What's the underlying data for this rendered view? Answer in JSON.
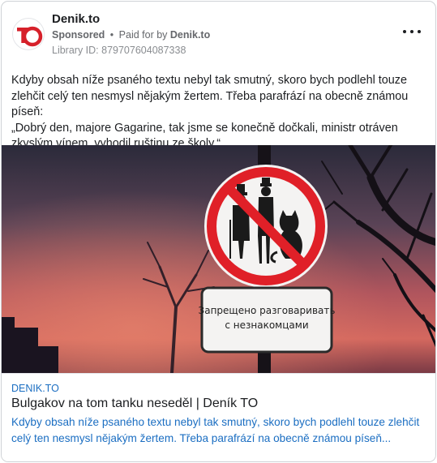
{
  "ad": {
    "page_name": "Denik.to",
    "logo_text": "TO",
    "sponsored_label": "Sponsored",
    "separator": "•",
    "paid_for_prefix": "Paid for by",
    "payer_name": "Denik.to",
    "library_id": "Library ID: 879707604087338",
    "primary_text": "Kdyby obsah níže psaného textu nebyl tak smutný, skoro bych podlehl touze zlehčit celý ten nesmysl nějakým žertem. Třeba parafrází na obecně známou píseň:\n„Dobrý den, majore Gagarine, tak jsme se konečně dočkali, ministr otráven zkyslým vínem, vyhodil ruštinu ze školy.“"
  },
  "image": {
    "sign_line1": "Запрещено разговаривать",
    "sign_line2": "с незнакомцами"
  },
  "link": {
    "domain": "DENIK.TO",
    "headline": "Bulgakov na tom tanku neseděl | Deník TO",
    "description": "Kdyby obsah níže psaného textu nebyl tak smutný, skoro bych podlehl touze zlehčit celý ten nesmysl nějakým žertem. Třeba parafrází na obecně známou píseň..."
  },
  "colors": {
    "brand_red": "#d6202a",
    "link_blue": "#1b6ec2",
    "muted_text": "#65676b"
  }
}
